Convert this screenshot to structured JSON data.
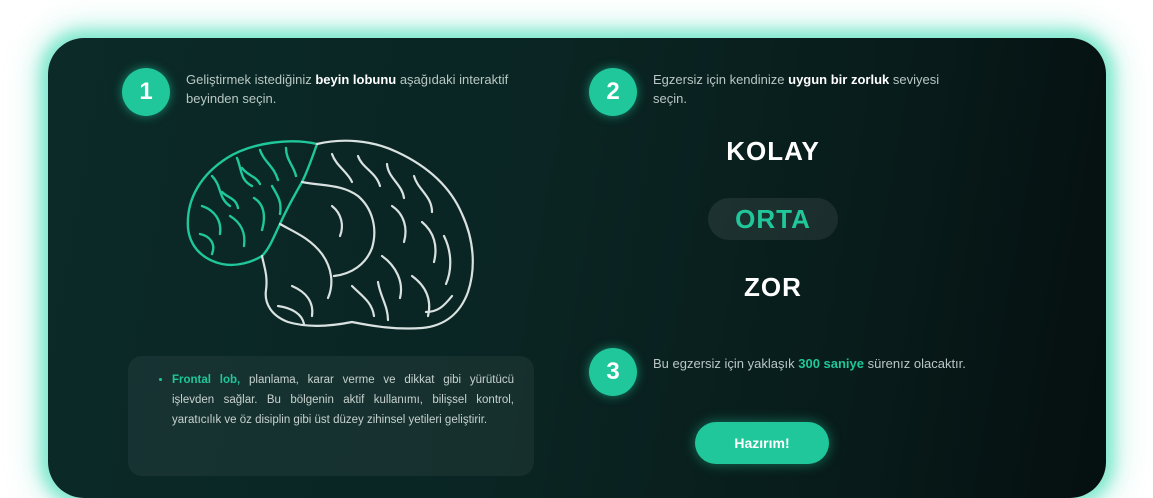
{
  "steps": [
    {
      "number": "1",
      "text_before": "Geliştirmek istediğiniz ",
      "text_bold": "beyin lobunu",
      "text_after": " aşağıdaki interaktif beyinden seçin."
    },
    {
      "number": "2",
      "text_before": "Egzersiz için kendinize ",
      "text_bold": "uygun bir zorluk",
      "text_after": " seviyesi seçin."
    },
    {
      "number": "3",
      "text_before": "Bu egzersiz için yaklaşık ",
      "text_accent": "300 saniye",
      "text_after": " sürenız olacaktır."
    }
  ],
  "difficulty": {
    "options": [
      "KOLAY",
      "ORTA",
      "ZOR"
    ],
    "selected": "ORTA"
  },
  "lobe_info": {
    "lobe_name": "Frontal lob,",
    "description": " planlama, karar verme ve dikkat gibi yürütücü işlevden sağlar. Bu bölgenin aktif kullanımı, bilişsel kontrol, yaratıcılık ve öz disiplin gibi üst düzey zihinsel yetileri geliştirir."
  },
  "ready_button": {
    "label": "Hazırım!"
  },
  "colors": {
    "accent": "#1fc79a",
    "card_background": "#0a2523",
    "brain_outline": "#d9e2e0",
    "selected_lobe": "#1fc79a"
  },
  "icons": {
    "brain": "brain-icon"
  }
}
